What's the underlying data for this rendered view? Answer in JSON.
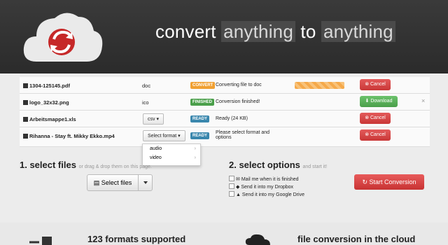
{
  "header": {
    "tagline_prefix": "convert ",
    "tagline_hl1": "anything",
    "tagline_mid": " to ",
    "tagline_hl2": "anything"
  },
  "files": [
    {
      "name": "1304-125145.pdf",
      "format": "doc",
      "badge": "CONVERT",
      "badge_color": "#f0a032",
      "status": "Converting file to doc",
      "progress": 0.65,
      "action": "Cancel"
    },
    {
      "name": "logo_32x32.png",
      "format": "ico",
      "badge": "FINISHED",
      "badge_color": "#4a9f4a",
      "status": "Conversion finished!",
      "action": "Download"
    },
    {
      "name": "Arbeitsmappe1.xls",
      "format": "csv ▾",
      "badge": "READY",
      "badge_color": "#3a87ad",
      "status": "Ready (24 KB)",
      "action": "Cancel"
    },
    {
      "name": "Rihanna - Stay ft. Mikky Ekko.mp4",
      "format": "Select format ▾",
      "badge": "READY",
      "badge_color": "#3a87ad",
      "status": "Please select format and",
      "status2": "options",
      "action": "Cancel"
    }
  ],
  "dropdown": [
    "audio",
    "video"
  ],
  "select_files": {
    "title": "1. select files",
    "sub": "or drag & drop them on this page.",
    "button": "Select files"
  },
  "options": {
    "title": "2. select options",
    "sub": "and start it!",
    "items": [
      "Mail me when it is finished",
      "Send it into my Dropbox",
      "Send it into my Google Drive"
    ],
    "start": "Start Conversion"
  },
  "features": [
    "123 formats supported",
    "file conversion in the cloud"
  ]
}
